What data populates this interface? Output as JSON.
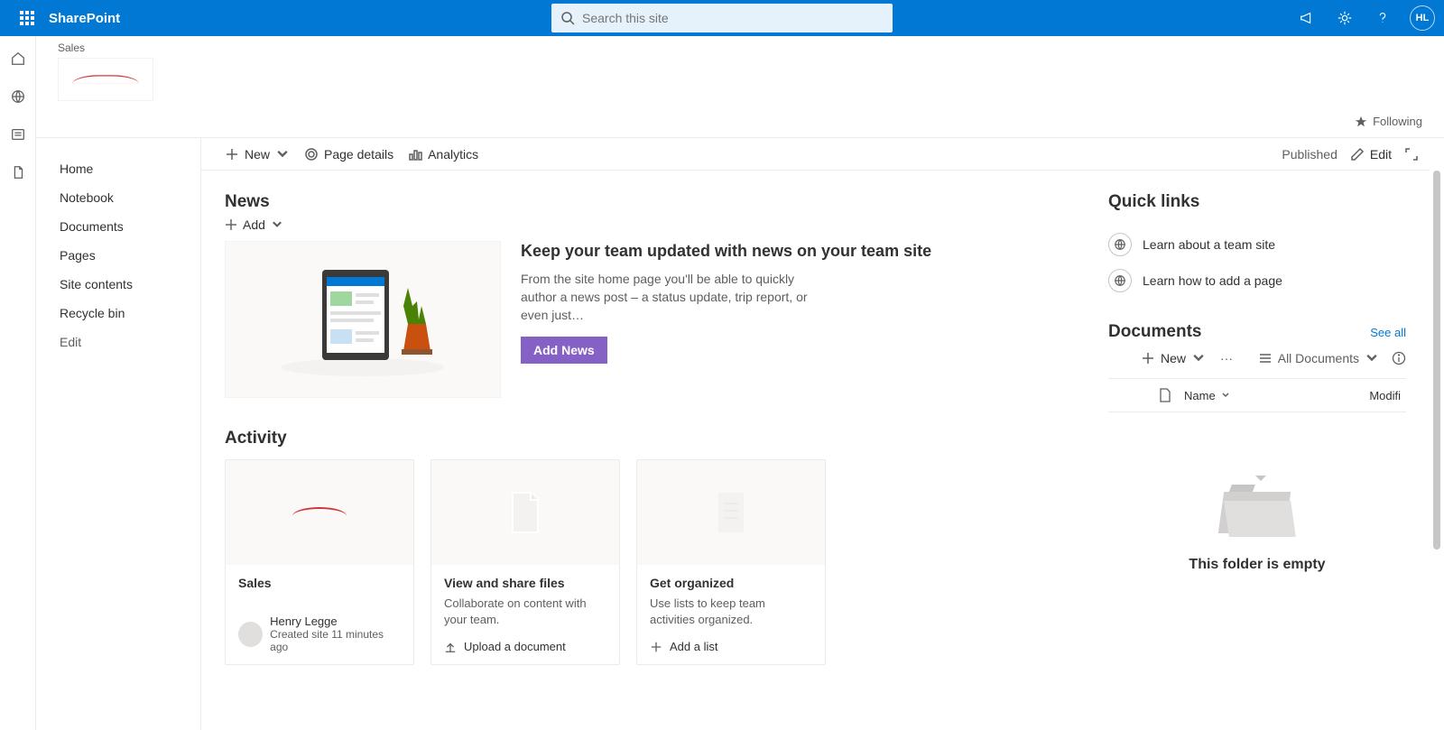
{
  "suite": {
    "app_name": "SharePoint",
    "search_placeholder": "Search this site",
    "avatar_initials": "HL"
  },
  "site": {
    "title": "Sales",
    "follow_label": "Following"
  },
  "left_nav": {
    "items": [
      "Home",
      "Notebook",
      "Documents",
      "Pages",
      "Site contents",
      "Recycle bin",
      "Edit"
    ]
  },
  "command_bar": {
    "new_label": "New",
    "page_details": "Page details",
    "analytics": "Analytics",
    "published": "Published",
    "edit": "Edit"
  },
  "news": {
    "heading": "News",
    "add_label": "Add",
    "title": "Keep your team updated with news on your team site",
    "body": "From the site home page you'll be able to quickly author a news post – a status update, trip report, or even just…",
    "button": "Add News"
  },
  "activity": {
    "heading": "Activity",
    "cards": [
      {
        "title": "Sales",
        "author": "Henry Legge",
        "meta": "Created site 11 minutes ago"
      },
      {
        "title": "View and share files",
        "desc": "Collaborate on content with your team.",
        "action": "Upload a document"
      },
      {
        "title": "Get organized",
        "desc": "Use lists to keep team activities organized.",
        "action": "Add a list"
      }
    ]
  },
  "quicklinks": {
    "heading": "Quick links",
    "items": [
      "Learn about a team site",
      "Learn how to add a page"
    ]
  },
  "documents": {
    "heading": "Documents",
    "see_all": "See all",
    "new_label": "New",
    "view_label": "All Documents",
    "col_name": "Name",
    "col_modified": "Modifi",
    "empty_text": "This folder is empty"
  }
}
